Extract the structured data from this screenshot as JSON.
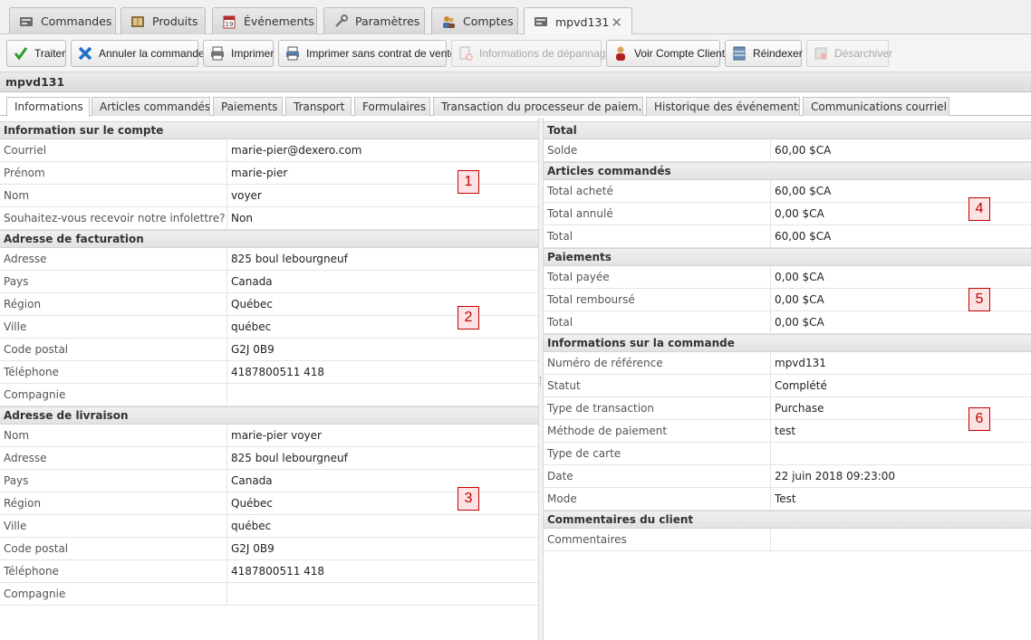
{
  "top_tabs": [
    {
      "label": "Commandes",
      "icon": "orders-icon"
    },
    {
      "label": "Produits",
      "icon": "products-icon"
    },
    {
      "label": "Événements",
      "icon": "calendar-icon"
    },
    {
      "label": "Paramètres",
      "icon": "wrench-icon"
    },
    {
      "label": "Comptes",
      "icon": "accounts-icon"
    },
    {
      "label": "mpvd131",
      "icon": "order-icon",
      "close": "✕"
    }
  ],
  "toolbar": {
    "process": "Traiter",
    "cancel_order": "Annuler la commande",
    "print": "Imprimer",
    "print_no_contract": "Imprimer sans contrat de vente",
    "troubleshooting": "Informations de dépannage",
    "view_account": "Voir Compte Client",
    "reindex": "Réindexer",
    "unarchive": "Désarchiver"
  },
  "order_id": "mpvd131",
  "sub_tabs": [
    "Informations",
    "Articles commandés",
    "Paiements",
    "Transport",
    "Formulaires",
    "Transaction du processeur de paiem...",
    "Historique des événements",
    "Communications courriel"
  ],
  "left": {
    "account": {
      "title": "Information sur le compte",
      "rows": [
        {
          "label": "Courriel",
          "value": "marie-pier@dexero.com"
        },
        {
          "label": "Prénom",
          "value": "marie-pier"
        },
        {
          "label": "Nom",
          "value": "voyer"
        },
        {
          "label": "Souhaitez-vous recevoir notre infolettre?",
          "value": "Non"
        }
      ]
    },
    "billing": {
      "title": "Adresse de facturation",
      "rows": [
        {
          "label": "Adresse",
          "value": "825 boul lebourgneuf"
        },
        {
          "label": "Pays",
          "value": "Canada"
        },
        {
          "label": "Région",
          "value": "Québec"
        },
        {
          "label": "Ville",
          "value": "québec"
        },
        {
          "label": "Code postal",
          "value": "G2J 0B9"
        },
        {
          "label": "Téléphone",
          "value": "4187800511 418"
        },
        {
          "label": "Compagnie",
          "value": ""
        }
      ]
    },
    "shipping": {
      "title": "Adresse de livraison",
      "rows": [
        {
          "label": "Nom",
          "value": "marie-pier voyer"
        },
        {
          "label": "Adresse",
          "value": "825 boul lebourgneuf"
        },
        {
          "label": "Pays",
          "value": "Canada"
        },
        {
          "label": "Région",
          "value": "Québec"
        },
        {
          "label": "Ville",
          "value": "québec"
        },
        {
          "label": "Code postal",
          "value": "G2J 0B9"
        },
        {
          "label": "Téléphone",
          "value": "4187800511 418"
        },
        {
          "label": "Compagnie",
          "value": ""
        }
      ]
    }
  },
  "right": {
    "total": {
      "title": "Total",
      "rows": [
        {
          "label": "Solde",
          "value": "60,00 $CA"
        }
      ]
    },
    "items": {
      "title": "Articles commandés",
      "rows": [
        {
          "label": "Total acheté",
          "value": "60,00 $CA"
        },
        {
          "label": "Total annulé",
          "value": "0,00 $CA"
        },
        {
          "label": "Total",
          "value": "60,00 $CA"
        }
      ]
    },
    "payments": {
      "title": "Paiements",
      "rows": [
        {
          "label": "Total payée",
          "value": "0,00 $CA"
        },
        {
          "label": "Total remboursé",
          "value": "0,00 $CA"
        },
        {
          "label": "Total",
          "value": "0,00 $CA"
        }
      ]
    },
    "order_info": {
      "title": "Informations sur la commande",
      "rows": [
        {
          "label": "Numéro de référence",
          "value": "mpvd131"
        },
        {
          "label": "Statut",
          "value": "Complété"
        },
        {
          "label": "Type de transaction",
          "value": "Purchase"
        },
        {
          "label": "Méthode de paiement",
          "value": "test"
        },
        {
          "label": "Type de carte",
          "value": ""
        },
        {
          "label": "Date",
          "value": "22 juin 2018 09:23:00"
        },
        {
          "label": "Mode",
          "value": "Test"
        }
      ]
    },
    "comments": {
      "title": "Commentaires du client",
      "rows": [
        {
          "label": "Commentaires",
          "value": ""
        }
      ]
    }
  },
  "markers": [
    "1",
    "2",
    "3",
    "4",
    "5",
    "6"
  ],
  "colors": {
    "marker_border": "#c00000",
    "marker_bg": "#fde3e3",
    "check_green": "#2a9d2a",
    "cross_blue": "#1e6fc9"
  }
}
